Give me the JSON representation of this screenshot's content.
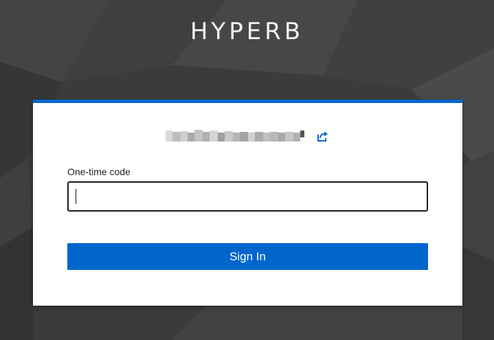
{
  "brand": {
    "title": "HYPERB"
  },
  "login": {
    "otp_label": "One-time code",
    "otp_value": "",
    "signin_label": "Sign In"
  },
  "colors": {
    "accent": "#0066cc",
    "background": "#3a3a3a",
    "card": "#ffffff"
  },
  "icons": {
    "restart": "restart-login-icon"
  }
}
